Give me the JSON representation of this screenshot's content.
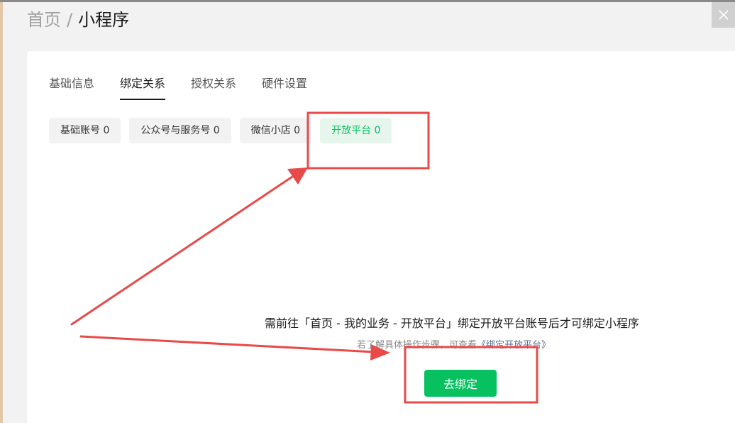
{
  "breadcrumb": {
    "home": "首页",
    "separator": "/",
    "current": "小程序"
  },
  "window": {
    "close_icon": "close-icon"
  },
  "tabs": [
    {
      "label": "基础信息",
      "active": false
    },
    {
      "label": "绑定关系",
      "active": true
    },
    {
      "label": "授权关系",
      "active": false
    },
    {
      "label": "硬件设置",
      "active": false
    }
  ],
  "subtabs": [
    {
      "label": "基础账号 0",
      "active": false
    },
    {
      "label": "公众号与服务号 0",
      "active": false
    },
    {
      "label": "微信小店 0",
      "active": false
    },
    {
      "label": "开放平台 0",
      "active": true
    }
  ],
  "empty_state": {
    "message": "需前往「首页 - 我的业务 - 开放平台」绑定开放平台账号后才可绑定小程序",
    "help_prefix": "若了解具体操作步骤，可查看",
    "help_link": "《绑定开放平台》",
    "button_label": "去绑定"
  },
  "colors": {
    "accent": "#07c160",
    "accent_light_bg": "#e6f6ec",
    "annotation_red": "#e84a4a",
    "link": "#576b95"
  }
}
